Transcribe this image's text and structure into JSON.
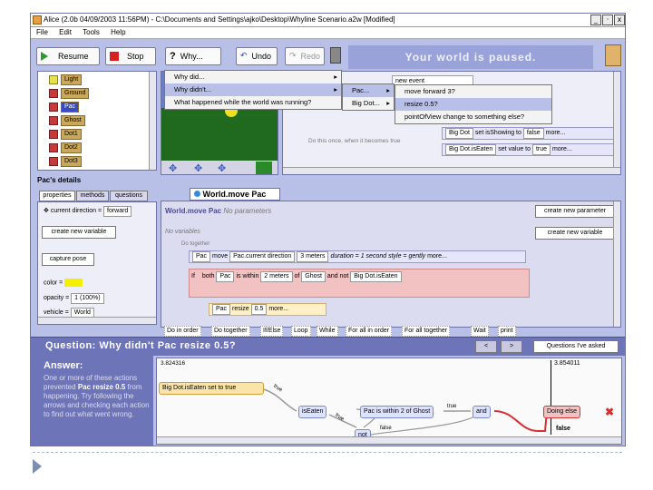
{
  "window": {
    "title": "Alice (2.0b 04/09/2003 11:56PM) - C:\\Documents and Settings\\ajko\\Desktop\\Whyline Scenario.a2w [Modified]",
    "controls": [
      "_",
      "·",
      "x"
    ]
  },
  "menubar": [
    "File",
    "Edit",
    "Tools",
    "Help"
  ],
  "toolbar": {
    "resume": "Resume",
    "stop": "Stop",
    "why": "Why...",
    "undo": "Undo",
    "redo": "Redo",
    "status": "Your world is paused."
  },
  "object_tree": [
    "Light",
    "Ground",
    "Pac",
    "Ghost",
    "Dot1",
    "Dot2",
    "Dot3"
  ],
  "why_menu": {
    "items": [
      "Why did...",
      "Why didn't...",
      "What happened while the world was running?"
    ],
    "submenu1": [
      "Pac...",
      "Big Dot..."
    ],
    "submenu2": [
      "move forward 3?",
      "resize 0.5?",
      "pointOfView change to something else?"
    ]
  },
  "events": {
    "partial_header": "new event",
    "while_text": "Do this once, when it becomes true",
    "rows": [
      {
        "obj": "Big Dot",
        "verb": "set isShowing to",
        "val": "false",
        "more": "more..."
      },
      {
        "obj": "Big Dot.isEaten",
        "verb": "set value to",
        "val": "true",
        "more": "more..."
      }
    ],
    "tooltip": "true"
  },
  "details": {
    "title": "Pac's details",
    "tabs": [
      "properties",
      "methods",
      "questions"
    ],
    "current_direction_label": "current direction",
    "current_direction_value": "forward",
    "create_var": "create new variable",
    "capture_pose": "capture pose",
    "color_label": "color",
    "opacity_label": "opacity",
    "opacity_value": "1 (100%)",
    "vehicle_label": "vehicle",
    "vehicle_value": "World"
  },
  "editor": {
    "tab": "World.move Pac",
    "header": "World.move Pac",
    "no_params": "No parameters",
    "create_param": "create new parameter",
    "no_vars": "No variables",
    "create_var": "create new variable",
    "partial_block": "Do together",
    "line1": {
      "obj": "Pac",
      "verb": "move",
      "dir": "Pac.current direction",
      "amount": "3 meters",
      "duration": "duration = 1 second",
      "style": "style = gently",
      "more": "more..."
    },
    "line2": {
      "kw": "If",
      "both": "both",
      "obj": "Pac",
      "cond": "is within",
      "dist": "2 meters",
      "of": "of",
      "target": "Ghost",
      "and": "and",
      "not": "not",
      "isEaten": "Big Dot.isEaten"
    },
    "line3": {
      "obj": "Pac",
      "verb": "resize",
      "amount": "0.5",
      "more": "more..."
    }
  },
  "controls_bar": [
    "Do in order",
    "Do together",
    "If/Else",
    "Loop",
    "While",
    "For all in order",
    "For all together",
    "Wait",
    "print"
  ],
  "question": {
    "text": "Question: Why didn't Pac resize 0.5?",
    "nav_prev": "<",
    "nav_next": ">",
    "asked": "Questions I've asked"
  },
  "answer": {
    "title": "Answer:",
    "text_parts": [
      "One or more of these actions prevented ",
      "Pac resize 0.5",
      " from happening. Try following the arrows and checking each action to find out what went wrong."
    ]
  },
  "timeline": {
    "start_time": "3.824316",
    "cursor_time": "3.854011",
    "nodes": [
      "Big Dot.isEaten set to true",
      "isEaten",
      "not",
      "Pac is within 2 of Ghost",
      "and",
      "Doing else"
    ],
    "labels": {
      "true1": "true",
      "true2": "true",
      "false1": "false",
      "true3": "true",
      "false2": "false"
    }
  },
  "colors": {
    "window_bg": "#b9c0e8",
    "answer_bg": "#6d74b8",
    "highlight": "#f2c2c2",
    "accent": "#d83030"
  }
}
